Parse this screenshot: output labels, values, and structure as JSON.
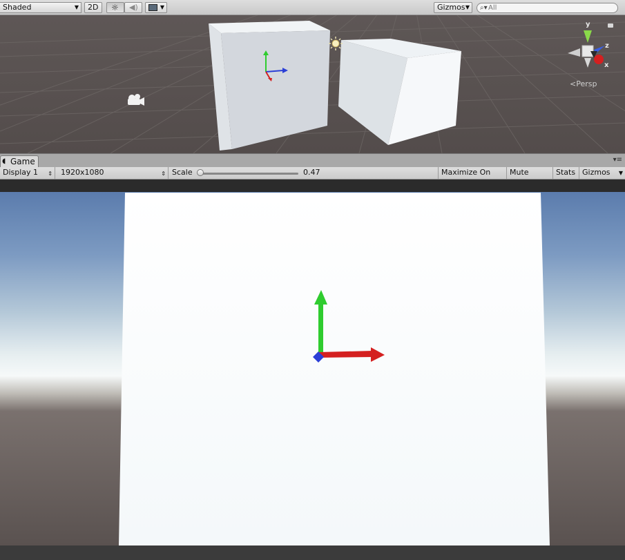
{
  "scene_toolbar": {
    "shading_mode": "Shaded",
    "mode_2d": "2D",
    "gizmos_label": "Gizmos",
    "search_placeholder": "All"
  },
  "scene_view": {
    "projection_label": "Persp",
    "axis_labels": {
      "y": "y",
      "z": "z",
      "x": "x"
    }
  },
  "game_tab": {
    "title": "Game"
  },
  "game_toolbar": {
    "display": "Display 1",
    "resolution": "1920x1080",
    "scale_label": "Scale",
    "scale_value": "0.47",
    "scale_fraction": 0.05,
    "maximize_on_play": "Maximize On Play",
    "mute_audio": "Mute Audio",
    "stats": "Stats",
    "gizmos": "Gizmos"
  },
  "colors": {
    "x_axis": "#d42020",
    "y_axis": "#2fcc2f",
    "z_axis": "#2b3fd6",
    "sky_top": "#5b7cad",
    "sky_horizon": "#f2f6f7",
    "ground": "#5a5250"
  },
  "icons": [
    "lighting-icon",
    "audio-icon",
    "effects-icon",
    "camera-gizmo-icon",
    "light-gizmo-icon",
    "search-icon",
    "tab-menu-icon"
  ]
}
